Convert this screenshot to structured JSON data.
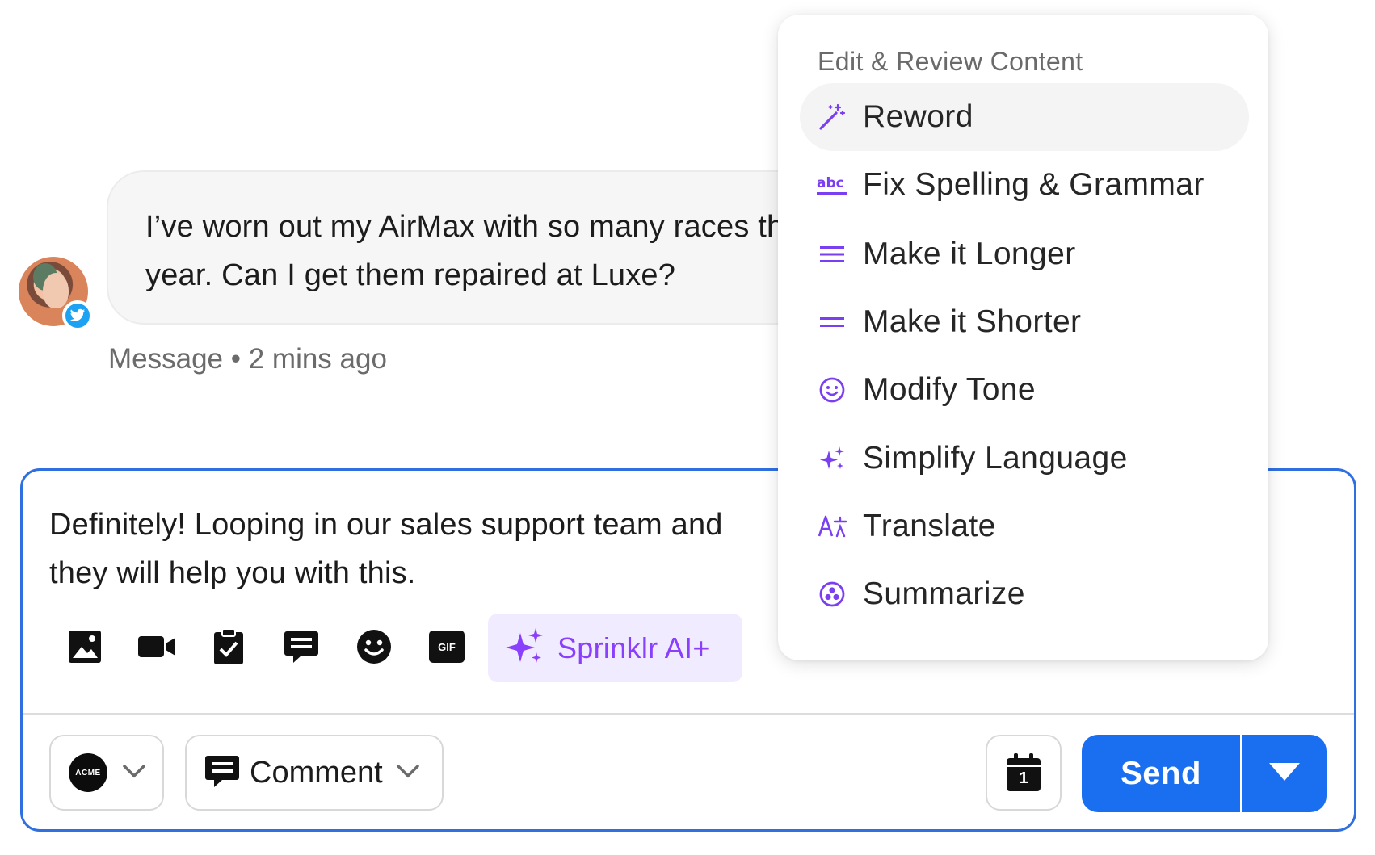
{
  "message": {
    "text": "I’ve worn out my AirMax with so many races this year. Can I get them repaired at Luxe?",
    "meta": "Message • 2 mins ago",
    "channel_icon": "twitter-icon"
  },
  "composer": {
    "draft_text": "Definitely! Looping in our sales support team and they will help you with this.",
    "toolbar_icons": [
      "image-icon",
      "video-icon",
      "clipboard-check-icon",
      "message-icon",
      "emoji-icon",
      "gif-icon"
    ],
    "gif_label": "GIF",
    "ai_button_label": "Sprinklr AI+",
    "account_logo_text": "ACME",
    "comment_type_label": "Comment",
    "calendar_day": "1",
    "send_label": "Send",
    "colors": {
      "primary": "#1a6ef0",
      "ai_accent": "#8a3ffc",
      "ai_bg": "#f1ebff",
      "border_focus": "#2f6fe0"
    }
  },
  "menu": {
    "heading": "Edit & Review Content",
    "items": [
      {
        "label": "Reword",
        "icon": "magic-wand-icon",
        "active": true
      },
      {
        "label": "Fix Spelling & Grammar",
        "icon": "spellcheck-abc-icon",
        "active": false
      },
      {
        "label": "Make it Longer",
        "icon": "lines-three-icon",
        "active": false
      },
      {
        "label": "Make it Shorter",
        "icon": "lines-two-icon",
        "active": false
      },
      {
        "label": "Modify Tone",
        "icon": "smiley-icon",
        "active": false
      },
      {
        "label": "Simplify Language",
        "icon": "sparkle-icon",
        "active": false
      },
      {
        "label": "Translate",
        "icon": "translate-icon",
        "active": false
      },
      {
        "label": "Summarize",
        "icon": "summarize-icon",
        "active": false
      }
    ]
  }
}
